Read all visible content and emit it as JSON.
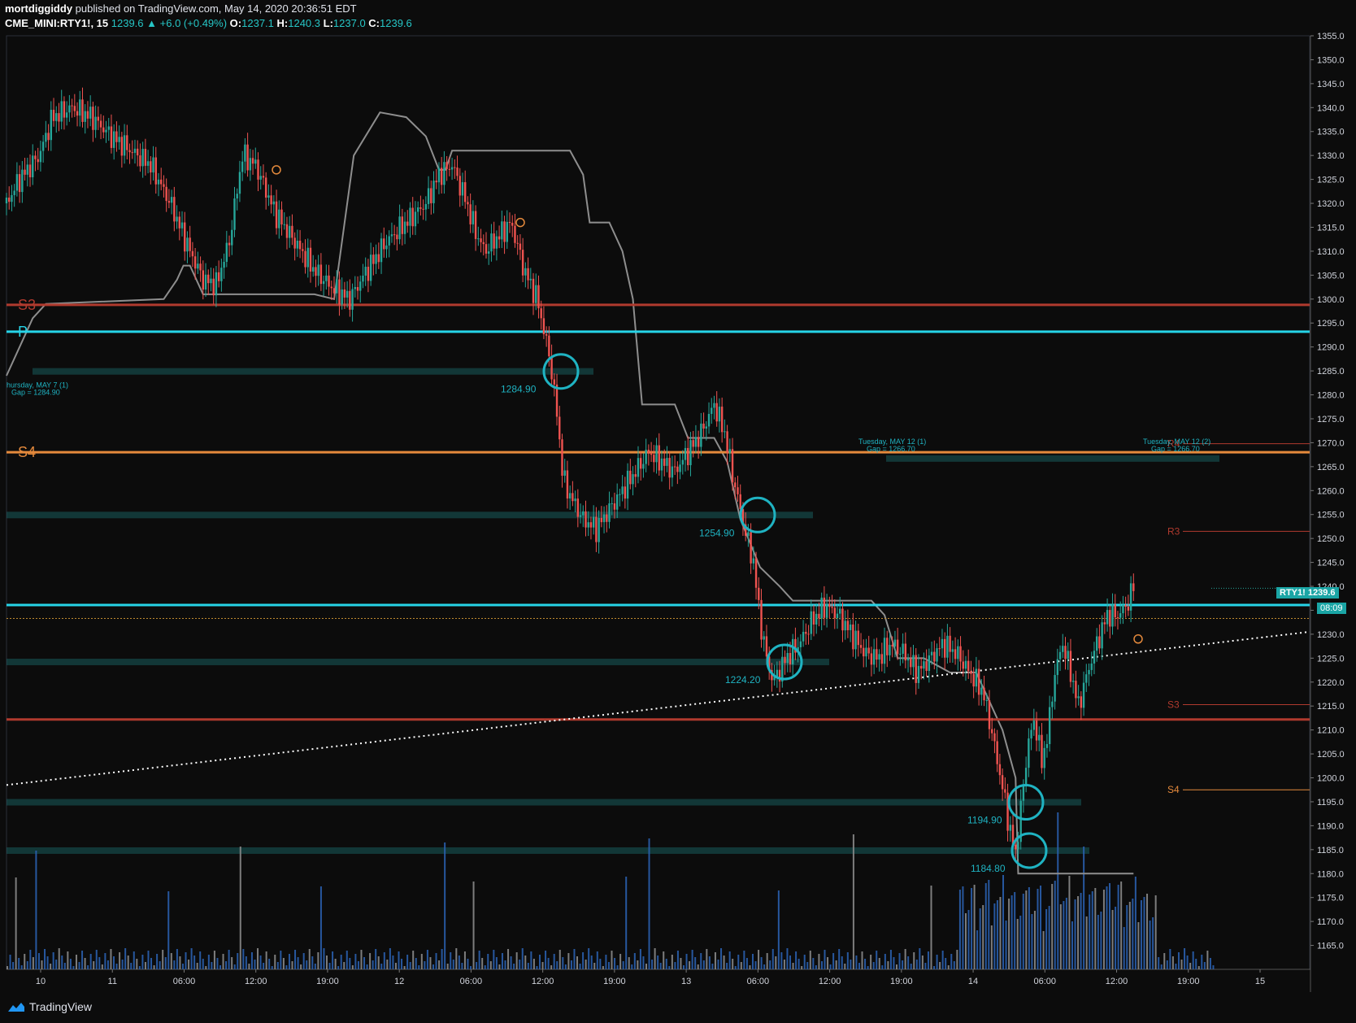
{
  "header": {
    "author": "mortdiggiddy",
    "published_text": "published on TradingView.com, May 14, 2020 20:36:51 EDT",
    "symbol": "CME_MINI:RTY1!, 15",
    "last": "1239.6",
    "change": "+6.0 (+0.49%)",
    "open_label": "O:",
    "open": "1237.1",
    "high_label": "H:",
    "high": "1240.3",
    "low_label": "L:",
    "low": "1237.0",
    "close_label": "C:",
    "close": "1239.6"
  },
  "footer": {
    "brand": "TradingView",
    "icon": "tradingview-logo-icon"
  },
  "price_tag": {
    "symbol": "RTY1!",
    "price": "1239.6",
    "countdown": "08:09"
  },
  "colors": {
    "background": "#0c0c0c",
    "up": "#26a69a",
    "down": "#ef5350",
    "pivot": "#26d4e8",
    "s3": "#b03a2e",
    "s4": "#e58a3c",
    "step": "#8e8e8e",
    "gap": "#1f8a8a",
    "circle": "#1fb3c2",
    "vol_up": "#2a5fae",
    "vol_down": "#8a8a8a"
  },
  "chart_data": {
    "type": "candlestick",
    "y_axis": {
      "range": [
        1160,
        1355
      ],
      "ticks": [
        "1355.0",
        "1350.0",
        "1345.0",
        "1340.0",
        "1335.0",
        "1330.0",
        "1325.0",
        "1320.0",
        "1315.0",
        "1310.0",
        "1305.0",
        "1300.0",
        "1295.0",
        "1290.0",
        "1285.0",
        "1280.0",
        "1275.0",
        "1270.0",
        "1265.0",
        "1260.0",
        "1255.0",
        "1250.0",
        "1245.0",
        "1240.0",
        "1235.0",
        "1230.0",
        "1225.0",
        "1220.0",
        "1215.0",
        "1210.0",
        "1205.0",
        "1200.0",
        "1195.0",
        "1190.0",
        "1185.0",
        "1180.0",
        "1175.0",
        "1170.0",
        "1165.0"
      ]
    },
    "x_axis": {
      "ticks": [
        "10",
        "11",
        "06:00",
        "12:00",
        "19:00",
        "12",
        "06:00",
        "12:00",
        "19:00",
        "13",
        "06:00",
        "12:00",
        "19:00",
        "14",
        "06:00",
        "12:00",
        "19:00",
        "15"
      ]
    },
    "price_path": [
      [
        0,
        1320
      ],
      [
        10,
        1325
      ],
      [
        25,
        1330
      ],
      [
        35,
        1338
      ],
      [
        50,
        1340
      ],
      [
        65,
        1338
      ],
      [
        80,
        1334
      ],
      [
        95,
        1331
      ],
      [
        110,
        1328
      ],
      [
        125,
        1320
      ],
      [
        140,
        1310
      ],
      [
        150,
        1304
      ],
      [
        160,
        1303
      ],
      [
        170,
        1312
      ],
      [
        180,
        1330
      ],
      [
        190,
        1328
      ],
      [
        205,
        1318
      ],
      [
        220,
        1312
      ],
      [
        235,
        1306
      ],
      [
        250,
        1302
      ],
      [
        262,
        1300
      ],
      [
        275,
        1306
      ],
      [
        290,
        1312
      ],
      [
        305,
        1316
      ],
      [
        320,
        1320
      ],
      [
        330,
        1326
      ],
      [
        340,
        1328
      ],
      [
        350,
        1321
      ],
      [
        358,
        1314
      ],
      [
        365,
        1310
      ],
      [
        375,
        1313
      ],
      [
        385,
        1316
      ],
      [
        395,
        1306
      ],
      [
        405,
        1300
      ],
      [
        415,
        1287
      ],
      [
        420,
        1276
      ],
      [
        425,
        1262
      ],
      [
        432,
        1258
      ],
      [
        440,
        1254
      ],
      [
        450,
        1252
      ],
      [
        460,
        1256
      ],
      [
        470,
        1260
      ],
      [
        480,
        1264
      ],
      [
        490,
        1268
      ],
      [
        500,
        1266
      ],
      [
        510,
        1264
      ],
      [
        520,
        1268
      ],
      [
        530,
        1272
      ],
      [
        540,
        1278
      ],
      [
        548,
        1272
      ],
      [
        555,
        1262
      ],
      [
        560,
        1256
      ],
      [
        565,
        1250
      ],
      [
        570,
        1245
      ],
      [
        575,
        1233
      ],
      [
        580,
        1225
      ],
      [
        585,
        1220
      ],
      [
        595,
        1225
      ],
      [
        605,
        1228
      ],
      [
        615,
        1233
      ],
      [
        625,
        1236
      ],
      [
        635,
        1234
      ],
      [
        645,
        1230
      ],
      [
        655,
        1226
      ],
      [
        665,
        1225
      ],
      [
        675,
        1228
      ],
      [
        685,
        1226
      ],
      [
        695,
        1222
      ],
      [
        705,
        1225
      ],
      [
        715,
        1228
      ],
      [
        725,
        1226
      ],
      [
        735,
        1222
      ],
      [
        745,
        1218
      ],
      [
        750,
        1212
      ],
      [
        755,
        1205
      ],
      [
        760,
        1198
      ],
      [
        765,
        1190
      ],
      [
        770,
        1184
      ],
      [
        775,
        1196
      ],
      [
        780,
        1208
      ],
      [
        785,
        1212
      ],
      [
        790,
        1203
      ],
      [
        795,
        1210
      ],
      [
        800,
        1222
      ],
      [
        806,
        1228
      ],
      [
        812,
        1222
      ],
      [
        818,
        1215
      ],
      [
        825,
        1222
      ],
      [
        832,
        1228
      ],
      [
        840,
        1234
      ],
      [
        848,
        1234
      ],
      [
        855,
        1236
      ],
      [
        860,
        1240
      ]
    ],
    "series": [
      {
        "name": "P",
        "value": 1293.2
      },
      {
        "name": "S3",
        "value": 1298.8
      },
      {
        "name": "S4",
        "value": 1268.0
      },
      {
        "name": "S3",
        "value": 1215.3
      },
      {
        "name": "S4",
        "value": 1197.5
      },
      {
        "name": "R3",
        "value": 1251.5
      },
      {
        "name": "R4",
        "value": 1269.8
      }
    ],
    "levels": [
      {
        "label": "P",
        "value": 1293.2,
        "color": "#26d4e8",
        "width": 3
      },
      {
        "label": "S3",
        "value": 1298.8,
        "color": "#b03a2e",
        "width": 3
      },
      {
        "label": "S4",
        "value": 1268.0,
        "color": "#e58a3c",
        "width": 3
      },
      {
        "label": "",
        "value": 1236.1,
        "color": "#26d4e8",
        "width": 3
      },
      {
        "label": "",
        "value": 1212.2,
        "color": "#b03a2e",
        "width": 3
      },
      {
        "label": "",
        "value": 1233.3,
        "color": "#c08b30",
        "width": 1,
        "dotted": true
      }
    ],
    "right_levels": [
      {
        "label": "R4",
        "value": 1269.8,
        "color": "#b03a2e"
      },
      {
        "label": "R3",
        "value": 1251.5,
        "color": "#b03a2e"
      },
      {
        "label": "S3",
        "value": 1215.3,
        "color": "#b03a2e"
      },
      {
        "label": "S4",
        "value": 1197.5,
        "color": "#e58a3c"
      }
    ],
    "gaps": [
      {
        "label": "1284.90",
        "value": 1284.9,
        "title": "hursday, MAY 7 (1)",
        "subtitle": "Gap = 1284.90"
      },
      {
        "label": "1254.90",
        "value": 1254.9
      },
      {
        "label": "1224.20",
        "value": 1224.2
      },
      {
        "label": "1194.90",
        "value": 1194.9
      },
      {
        "label": "1184.80",
        "value": 1184.8
      }
    ],
    "gap_notes": [
      {
        "title": "Tuesday, MAY 12 (1)",
        "subtitle": "Gap = 1266.70",
        "value": 1266.7
      },
      {
        "title": "Tuesday, MAY 12 (2)",
        "subtitle": "Gap = 1266.70",
        "value": 1266.7
      }
    ],
    "trendline": {
      "from": [
        1198.5
      ],
      "to": [
        1230.5
      ],
      "style": "dotted"
    },
    "step_line": [
      [
        0,
        1284
      ],
      [
        10,
        1290
      ],
      [
        20,
        1296
      ],
      [
        30,
        1299
      ],
      [
        120,
        1300
      ],
      [
        130,
        1304
      ],
      [
        135,
        1307
      ],
      [
        140,
        1307
      ],
      [
        150,
        1301
      ],
      [
        235,
        1301
      ],
      [
        250,
        1300
      ],
      [
        265,
        1330
      ],
      [
        285,
        1339
      ],
      [
        305,
        1338
      ],
      [
        320,
        1334
      ],
      [
        330,
        1327
      ],
      [
        335,
        1327
      ],
      [
        340,
        1331
      ],
      [
        430,
        1331
      ],
      [
        440,
        1326
      ],
      [
        445,
        1316
      ],
      [
        460,
        1316
      ],
      [
        470,
        1310
      ],
      [
        478,
        1300
      ],
      [
        485,
        1278
      ],
      [
        510,
        1278
      ],
      [
        520,
        1271
      ],
      [
        540,
        1271
      ],
      [
        550,
        1266
      ],
      [
        560,
        1254
      ],
      [
        575,
        1244
      ],
      [
        590,
        1240
      ],
      [
        600,
        1237
      ],
      [
        660,
        1237
      ],
      [
        670,
        1234
      ],
      [
        680,
        1225
      ],
      [
        700,
        1225
      ],
      [
        720,
        1222
      ],
      [
        740,
        1222
      ],
      [
        760,
        1210
      ],
      [
        770,
        1200
      ],
      [
        772,
        1180
      ],
      [
        860,
        1180
      ]
    ],
    "volume": {
      "ylim": [
        0,
        100
      ]
    }
  }
}
